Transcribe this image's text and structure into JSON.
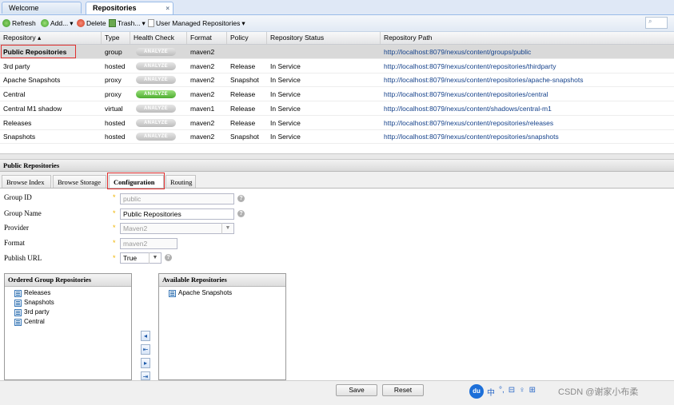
{
  "tabs": [
    {
      "label": "Welcome"
    },
    {
      "label": "Repositories",
      "close": "×"
    }
  ],
  "toolbar": {
    "refresh": "Refresh",
    "add": "Add...",
    "delete": "Delete",
    "trash": "Trash...",
    "user_managed": "User Managed Repositories",
    "dropdown_arrow": "▾",
    "search_icon": "🔍"
  },
  "grid": {
    "columns": [
      "Repository ▴",
      "Type",
      "Health Check",
      "Format",
      "Policy",
      "Repository Status",
      "Repository Path"
    ],
    "analyze_label": "ANALYZE",
    "rows": [
      {
        "name": "Public Repositories",
        "type": "group",
        "health": "off",
        "format": "maven2",
        "policy": "",
        "status": "",
        "path": "http://localhost:8079/nexus/content/groups/public"
      },
      {
        "name": "3rd party",
        "type": "hosted",
        "health": "off",
        "format": "maven2",
        "policy": "Release",
        "status": "In Service",
        "path": "http://localhost:8079/nexus/content/repositories/thirdparty"
      },
      {
        "name": "Apache Snapshots",
        "type": "proxy",
        "health": "off",
        "format": "maven2",
        "policy": "Snapshot",
        "status": "In Service",
        "path": "http://localhost:8079/nexus/content/repositories/apache-snapshots"
      },
      {
        "name": "Central",
        "type": "proxy",
        "health": "on",
        "format": "maven2",
        "policy": "Release",
        "status": "In Service",
        "path": "http://localhost:8079/nexus/content/repositories/central"
      },
      {
        "name": "Central M1 shadow",
        "type": "virtual",
        "health": "off",
        "format": "maven1",
        "policy": "Release",
        "status": "In Service",
        "path": "http://localhost:8079/nexus/content/shadows/central-m1"
      },
      {
        "name": "Releases",
        "type": "hosted",
        "health": "off",
        "format": "maven2",
        "policy": "Release",
        "status": "In Service",
        "path": "http://localhost:8079/nexus/content/repositories/releases"
      },
      {
        "name": "Snapshots",
        "type": "hosted",
        "health": "off",
        "format": "maven2",
        "policy": "Snapshot",
        "status": "In Service",
        "path": "http://localhost:8079/nexus/content/repositories/snapshots"
      }
    ]
  },
  "detail": {
    "title": "Public Repositories",
    "tabs": [
      "Browse Index",
      "Browse Storage",
      "Configuration",
      "Routing"
    ],
    "active_tab": "Configuration",
    "required_mark": "*",
    "help_mark": "?",
    "fields": {
      "group_id": {
        "label": "Group ID",
        "value": "public"
      },
      "group_name": {
        "label": "Group Name",
        "value": "Public Repositories"
      },
      "provider": {
        "label": "Provider",
        "value": "Maven2"
      },
      "format": {
        "label": "Format",
        "value": "maven2"
      },
      "publish_url": {
        "label": "Publish URL",
        "value": "True"
      }
    },
    "ordered": {
      "title": "Ordered Group Repositories",
      "items": [
        "Releases",
        "Snapshots",
        "3rd party",
        "Central"
      ]
    },
    "available": {
      "title": "Available Repositories",
      "items": [
        "Apache Snapshots"
      ]
    },
    "move_buttons": [
      "◂",
      "⇤",
      "▸",
      "⇥"
    ],
    "save": "Save",
    "reset": "Reset"
  },
  "watermark": "CSDN @谢家小布柔",
  "ime_bar": [
    "中",
    "°,",
    "⊟",
    "♀",
    "⊞"
  ],
  "colors": {
    "accent_blue": "#15428b",
    "selected_row": "#d9d9d9",
    "highlight_red": "#e0302f",
    "health_on": "#4cae2f"
  }
}
